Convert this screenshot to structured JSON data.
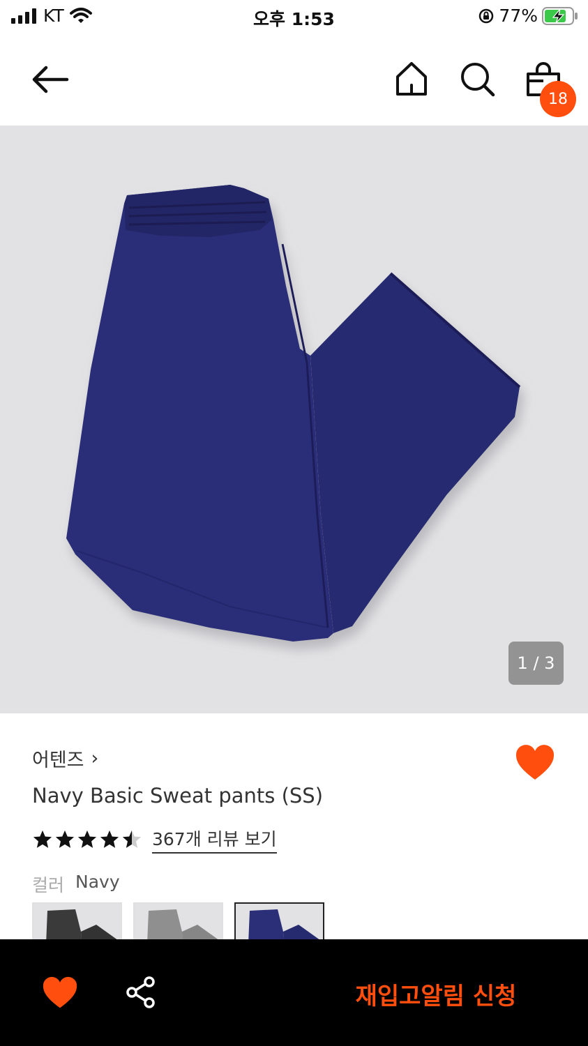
{
  "status_bar": {
    "carrier": "KT",
    "time": "오후 1:53",
    "battery": "77%"
  },
  "nav": {
    "back_icon": "arrow-left-icon",
    "home_icon": "home-icon",
    "search_icon": "search-icon",
    "bag_icon": "shopping-bag-icon",
    "cart_count": "18"
  },
  "gallery": {
    "counter": "1 / 3",
    "background": "#e2e2e4",
    "product_color": "#25286b"
  },
  "product": {
    "brand": "어텐즈",
    "brand_chevron": "›",
    "name": "Navy Basic Sweat pants (SS)",
    "rating": 4.5,
    "rating_max": 5,
    "review_link": "367개 리뷰 보기",
    "color_label": "컬러",
    "color_value": "Navy",
    "swatches": [
      {
        "name": "Black",
        "color": "#3a3a3a"
      },
      {
        "name": "Gray",
        "color": "#8d8d8d"
      },
      {
        "name": "Navy",
        "color": "#25286b",
        "selected": true
      }
    ]
  },
  "bottom_bar": {
    "restock_label": "재입고알림 신청",
    "accent": "#ff4e0d"
  }
}
